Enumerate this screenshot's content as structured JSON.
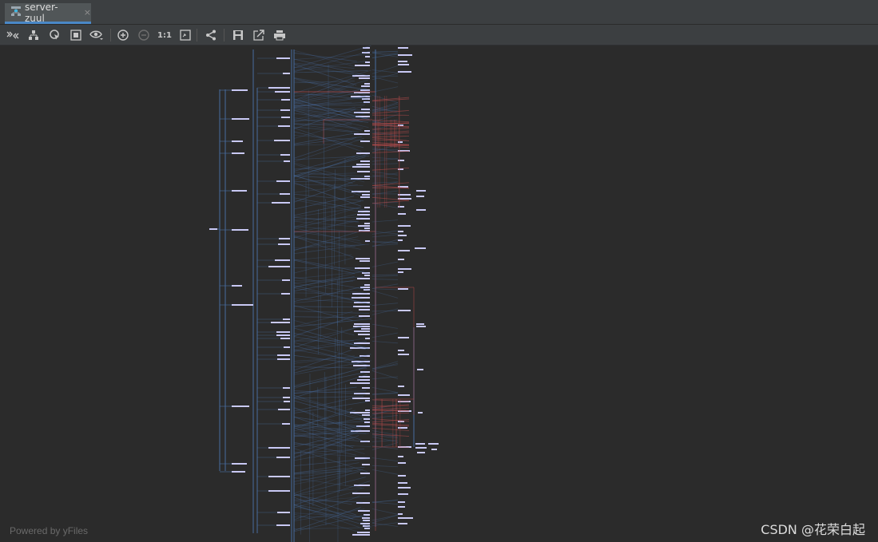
{
  "tab": {
    "label": "server-zuul",
    "icon": "diagram-icon",
    "close": "×"
  },
  "toolbar": {
    "buttons": [
      {
        "name": "expand-collapse-button",
        "icon": "double-chevron-icon"
      },
      {
        "name": "layout-button",
        "icon": "hierarchy-icon"
      },
      {
        "name": "select-button",
        "icon": "cursor-target-icon"
      },
      {
        "name": "fit-content-button",
        "icon": "fit-frame-icon"
      },
      {
        "name": "view-options-button",
        "icon": "eye-icon"
      },
      {
        "name": "zoom-in-button",
        "icon": "plus-circle-icon"
      },
      {
        "name": "zoom-out-button",
        "icon": "minus-circle-icon"
      },
      {
        "name": "actual-size-button",
        "icon": "one-to-one-icon",
        "label": "1:1"
      },
      {
        "name": "fit-window-button",
        "icon": "frame-icon"
      },
      {
        "name": "share-button",
        "icon": "share-icon"
      },
      {
        "name": "save-button",
        "icon": "floppy-icon"
      },
      {
        "name": "export-button",
        "icon": "export-icon"
      },
      {
        "name": "print-button",
        "icon": "printer-icon"
      }
    ]
  },
  "colors": {
    "background": "#2b2b2b",
    "node": "#c9c9f5",
    "edge_blue": "#4a6fa5",
    "edge_red": "#b54a4a"
  },
  "footer": {
    "powered_by": "Powered by yFiles"
  },
  "watermark": "CSDN @花荣白起"
}
